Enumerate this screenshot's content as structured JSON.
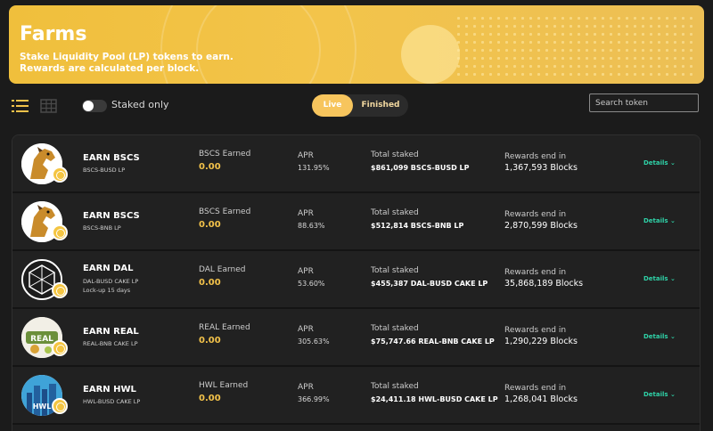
{
  "banner": {
    "title": "Farms",
    "subtitle_line1": "Stake Liquidity Pool (LP) tokens to earn.",
    "subtitle_line2": "Rewards are calculated per block."
  },
  "toolbar": {
    "staked_only_label": "Staked only",
    "staked_only_on": false,
    "tabs": [
      "Live",
      "Finished"
    ],
    "active_tab": "Live",
    "search_placeholder": "Search token"
  },
  "colors": {
    "accent": "#f3c24a",
    "details": "#2fd1a7",
    "background": "#1b1b1b"
  },
  "farms": [
    {
      "token_icon": "horse-bscs-icon",
      "earn_title": "EARN BSCS",
      "lp_name": "BSCS-BUSD LP",
      "lockup": "",
      "earned_label": "BSCS Earned",
      "earned_value": "0.00",
      "apr_label": "APR",
      "apr_value": "131.95%",
      "total_staked_label": "Total staked",
      "total_staked_value": "$861,099 BSCS-BUSD LP",
      "rewards_label": "Rewards end in",
      "rewards_value": "1,367,593 Blocks",
      "details_label": "Details"
    },
    {
      "token_icon": "horse-bscs-icon",
      "earn_title": "EARN BSCS",
      "lp_name": "BSCS-BNB LP",
      "lockup": "",
      "earned_label": "BSCS Earned",
      "earned_value": "0.00",
      "apr_label": "APR",
      "apr_value": "88.63%",
      "total_staked_label": "Total staked",
      "total_staked_value": "$512,814 BSCS-BNB LP",
      "rewards_label": "Rewards end in",
      "rewards_value": "2,870,599 Blocks",
      "details_label": "Details"
    },
    {
      "token_icon": "dal-geometric-icon",
      "earn_title": "EARN DAL",
      "lp_name": "DAL-BUSD CAKE LP",
      "lockup": "Lock-up 15 days",
      "earned_label": "DAL Earned",
      "earned_value": "0.00",
      "apr_label": "APR",
      "apr_value": "53.60%",
      "total_staked_label": "Total staked",
      "total_staked_value": "$455,387 DAL-BUSD CAKE LP",
      "rewards_label": "Rewards end in",
      "rewards_value": "35,868,189 Blocks",
      "details_label": "Details"
    },
    {
      "token_icon": "real-game-icon",
      "earn_title": "EARN REAL",
      "lp_name": "REAL-BNB CAKE LP",
      "lockup": "",
      "earned_label": "REAL Earned",
      "earned_value": "0.00",
      "apr_label": "APR",
      "apr_value": "305.63%",
      "total_staked_label": "Total staked",
      "total_staked_value": "$75,747.66 REAL-BNB CAKE LP",
      "rewards_label": "Rewards end in",
      "rewards_value": "1,290,229 Blocks",
      "details_label": "Details"
    },
    {
      "token_icon": "hwl-city-icon",
      "earn_title": "EARN HWL",
      "lp_name": "HWL-BUSD CAKE LP",
      "lockup": "",
      "earned_label": "HWL Earned",
      "earned_value": "0.00",
      "apr_label": "APR",
      "apr_value": "366.99%",
      "total_staked_label": "Total staked",
      "total_staked_value": "$24,411.18 HWL-BUSD CAKE LP",
      "rewards_label": "Rewards end in",
      "rewards_value": "1,268,041 Blocks",
      "details_label": "Details"
    }
  ]
}
